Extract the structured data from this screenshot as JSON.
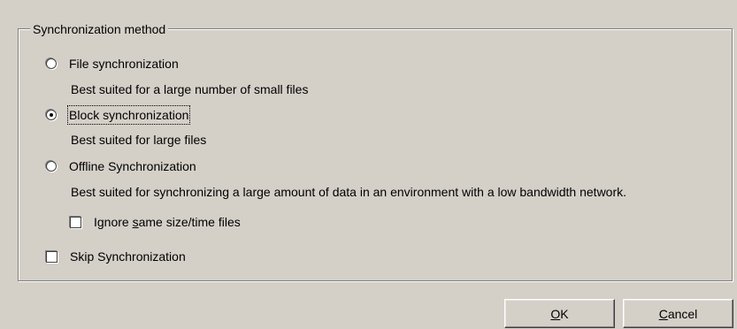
{
  "group": {
    "title": "Synchronization method"
  },
  "options": [
    {
      "label": "File synchronization",
      "description": "Best suited for a large number of small files",
      "selected": false
    },
    {
      "label": "Block synchronization",
      "description": "Best suited for large files",
      "selected": true
    },
    {
      "label": "Offline Synchronization",
      "description": "Best suited for synchronizing a large amount of data in an environment with a low bandwidth network.",
      "selected": false
    }
  ],
  "checkboxes": {
    "ignore_same": {
      "label_before": "Ignore ",
      "label_mnemonic": "s",
      "label_after": "ame size/time files",
      "checked": false
    },
    "skip_sync": {
      "label": "Skip Synchronization",
      "checked": false
    }
  },
  "buttons": {
    "ok": {
      "mnemonic": "O",
      "rest": "K"
    },
    "cancel": {
      "mnemonic": "C",
      "rest": "ancel"
    }
  }
}
